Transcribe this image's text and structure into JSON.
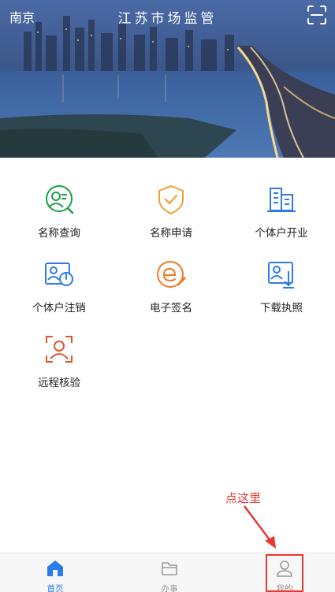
{
  "header": {
    "city": "南京",
    "title": "江苏市场监管"
  },
  "services": [
    {
      "label": "名称查询",
      "icon": "name-search-icon",
      "color": "#1aa04b"
    },
    {
      "label": "名称申请",
      "icon": "name-apply-shield-icon",
      "color": "#f0a030"
    },
    {
      "label": "个体户开业",
      "icon": "business-open-building-icon",
      "color": "#2d7be8"
    },
    {
      "label": "个体户注销",
      "icon": "business-cancel-icon",
      "color": "#2d7be8"
    },
    {
      "label": "电子签名",
      "icon": "e-signature-icon",
      "color": "#f07a22"
    },
    {
      "label": "下载执照",
      "icon": "download-license-icon",
      "color": "#2d7be8"
    },
    {
      "label": "远程核验",
      "icon": "remote-verify-face-icon",
      "color": "#e05530"
    }
  ],
  "annotation": {
    "text": "点这里",
    "color": "#e53935"
  },
  "tabbar": {
    "tabs": [
      {
        "label": "首页",
        "icon": "home-icon",
        "active": true
      },
      {
        "label": "办事",
        "icon": "folder-icon",
        "active": false
      },
      {
        "label": "我的",
        "icon": "person-icon",
        "active": false
      }
    ],
    "active_color": "#2d7be8"
  }
}
